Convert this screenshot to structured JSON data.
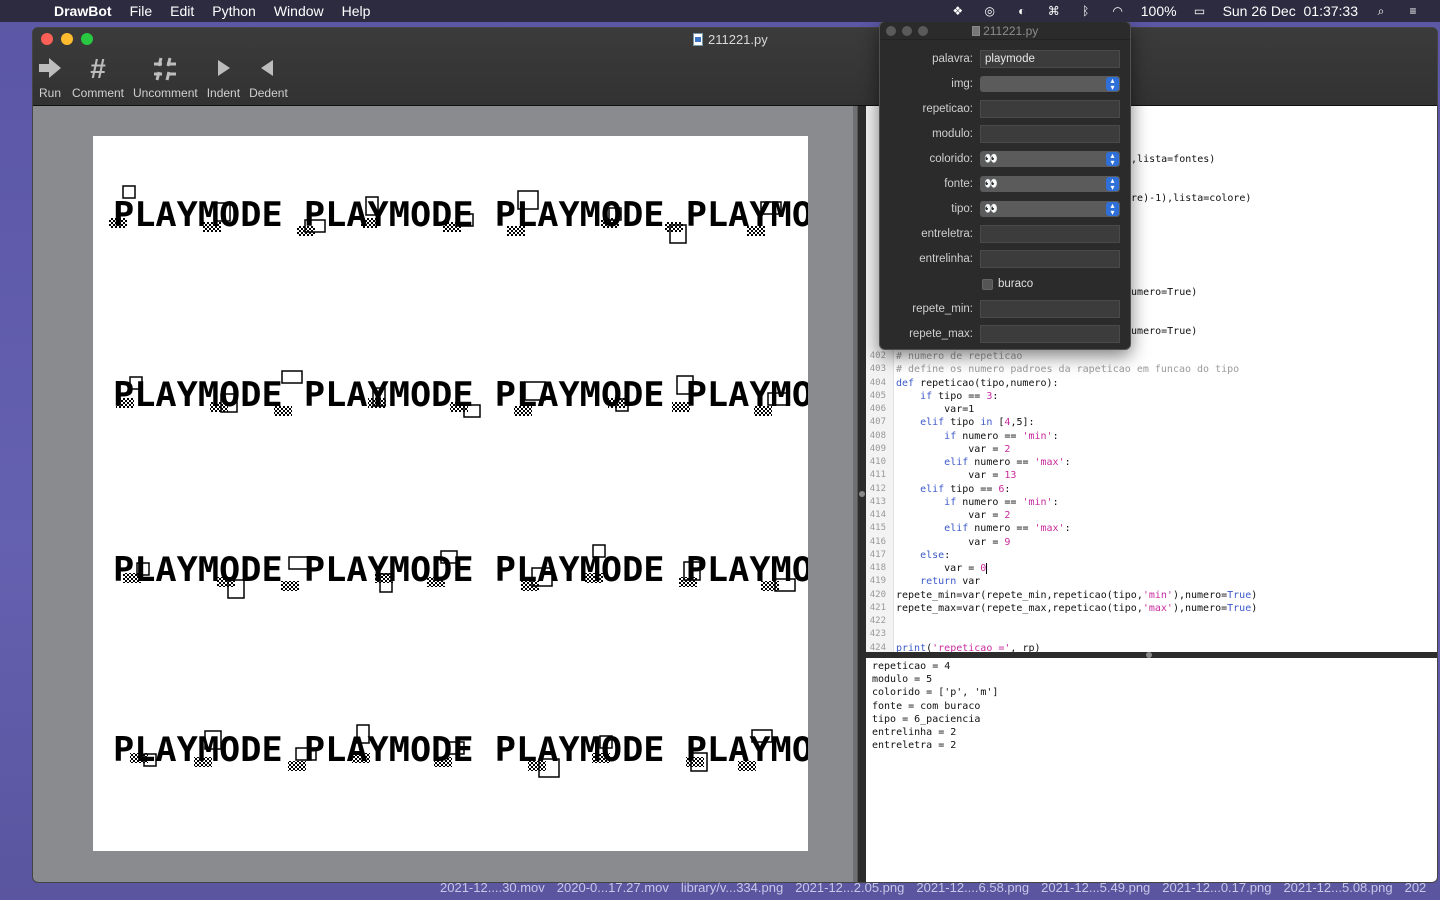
{
  "menubar": {
    "app": "DrawBot",
    "items": [
      "File",
      "Edit",
      "Python",
      "Window",
      "Help"
    ],
    "battery": "100%",
    "datetime": "Sun 26 Dec  01:37:33"
  },
  "window": {
    "title": "211221.py"
  },
  "toolbar": {
    "run": "Run",
    "comment": "Comment",
    "uncomment": "Uncomment",
    "indent": "Indent",
    "dedent": "Dedent"
  },
  "vars_panel": {
    "title": "211221.py",
    "palavra_label": "palavra:",
    "palavra_value": "playmode",
    "img_label": "img:",
    "repeticao_label": "repeticao:",
    "modulo_label": "modulo:",
    "colorido_label": "colorido:",
    "colorido_value": "👀",
    "fonte_label": "fonte:",
    "fonte_value": "👀",
    "tipo_label": "tipo:",
    "tipo_value": "👀",
    "entreletra_label": "entreletra:",
    "entrelinha_label": "entrelinha:",
    "buraco_label": "buraco",
    "repete_min_label": "repete_min:",
    "repete_max_label": "repete_max:"
  },
  "code_partial": {
    "l1": "1),lista=fontes)",
    "l2": "lore)-1),lista=colore)",
    "l3": ",numero=True)",
    "l4": ",numero=True)"
  },
  "code_lines": [
    {
      "n": "402",
      "t": "# numero de repeticao"
    },
    {
      "n": "403",
      "t": "# define os numero padroes da rapeticao em funcao do tipo"
    },
    {
      "n": "404",
      "t": "def repeticao(tipo,numero):"
    },
    {
      "n": "405",
      "t": "    if tipo == 3:"
    },
    {
      "n": "406",
      "t": "        var=1"
    },
    {
      "n": "407",
      "t": "    elif tipo in [4,5]:"
    },
    {
      "n": "408",
      "t": "        if numero == 'min':"
    },
    {
      "n": "409",
      "t": "            var = 2"
    },
    {
      "n": "410",
      "t": "        elif numero == 'max':"
    },
    {
      "n": "411",
      "t": "            var = 13"
    },
    {
      "n": "412",
      "t": "    elif tipo == 6:"
    },
    {
      "n": "413",
      "t": "        if numero == 'min':"
    },
    {
      "n": "414",
      "t": "            var = 2"
    },
    {
      "n": "415",
      "t": "        elif numero == 'max':"
    },
    {
      "n": "416",
      "t": "            var = 9"
    },
    {
      "n": "417",
      "t": "    else:"
    },
    {
      "n": "418",
      "t": "        var = 0"
    },
    {
      "n": "419",
      "t": "    return var"
    },
    {
      "n": "420",
      "t": "repete_min=var(repete_min,repeticao(tipo,'min'),numero=True)"
    },
    {
      "n": "421",
      "t": "repete_max=var(repete_max,repeticao(tipo,'max'),numero=True)"
    },
    {
      "n": "422",
      "t": ""
    },
    {
      "n": "423",
      "t": ""
    },
    {
      "n": "424",
      "t": "print('repeticao =', rp)"
    }
  ],
  "output_lines": [
    "repeticao = 4",
    "modulo = 5",
    "colorido = ['p', 'm']",
    "fonte = com buraco",
    "tipo = 6_paciencia",
    "entrelinha = 2",
    "entreletra = 2"
  ],
  "dock_files": [
    "2021-12....30.mov",
    "2020-0...17.27.mov",
    "library/v...334.png",
    "2021-12...2.05.png",
    "2021-12....6.58.png",
    "2021-12...5.49.png",
    "2021-12...0.17.png",
    "2021-12...5.08.png",
    "202"
  ],
  "canvas": {
    "word_rows": [
      "PLAYMODE PLAYMODE PLAYMODE PLAYMO",
      "PLAYMODE PLAYMODE PLAYMODE PLAYMO",
      "PLAYMODE PLAYMODE PLAYMODE PLAYMO",
      "PLAYMODE PLAYMODE PLAYMODE PLAYMO"
    ]
  }
}
